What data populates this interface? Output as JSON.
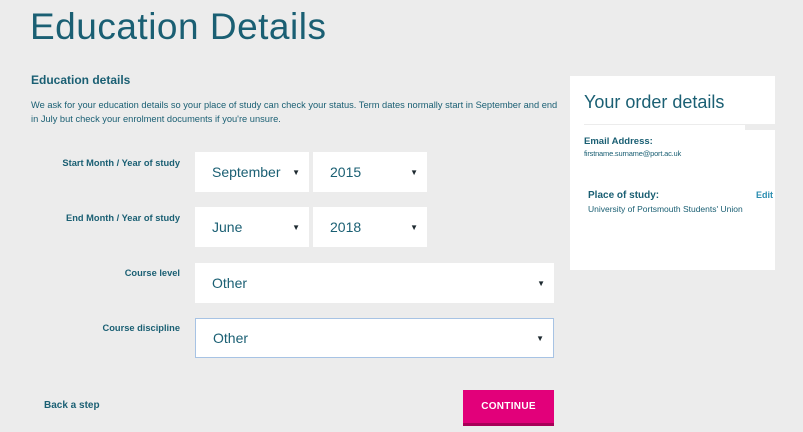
{
  "page_title": "Education Details",
  "section_heading": "Education details",
  "intro_text": "We ask for your education details so your place of study can check your status. Term dates normally start in September and end in July but check your enrolment documents if you're unsure.",
  "form": {
    "start": {
      "label": "Start Month / Year of study",
      "month": "September",
      "year": "2015"
    },
    "end": {
      "label": "End Month / Year of study",
      "month": "June",
      "year": "2018"
    },
    "course_level": {
      "label": "Course level",
      "value": "Other"
    },
    "course_discipline": {
      "label": "Course discipline",
      "value": "Other"
    }
  },
  "actions": {
    "back": "Back a step",
    "continue": "CONTINUE"
  },
  "order": {
    "title": "Your order details",
    "email_label": "Email Address:",
    "email_value": "firstname.surname@port.ac.uk",
    "place_label": "Place of study:",
    "place_value": "University of Portsmouth Students' Union",
    "edit": "Edit"
  },
  "colors": {
    "accent": "#1a5f73",
    "button": "#e2007a",
    "background": "#ececec"
  }
}
